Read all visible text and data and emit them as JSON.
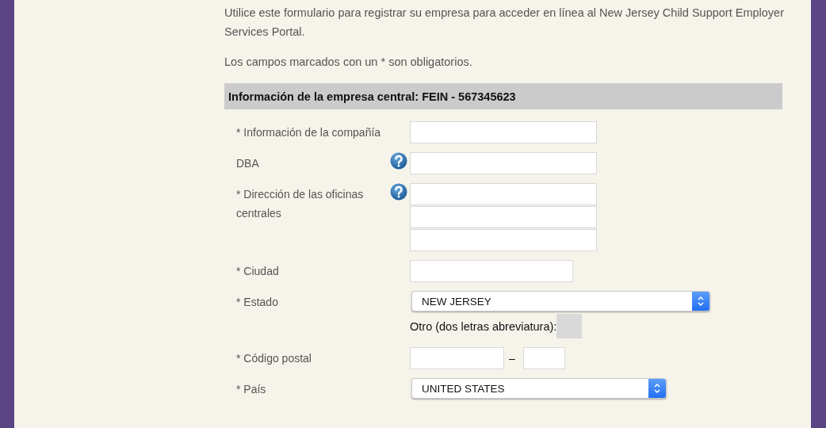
{
  "intro": "Utilice este formulario para registrar su empresa para acceder en línea al New Jersey Child Support Employer Services Portal.",
  "required_note": "Los campos marcados con un * son obligatorios.",
  "section": {
    "title": "Información de la empresa central: FEIN - 567345623"
  },
  "rows": [
    {
      "kind": "text",
      "label": "* Información de la compañía",
      "help": false
    },
    {
      "kind": "text",
      "label": "DBA",
      "help": true
    },
    {
      "kind": "address",
      "label": "* Dirección de las oficinas centrales",
      "help": true
    },
    {
      "kind": "short",
      "label": "* Ciudad",
      "help": false
    },
    {
      "kind": "select",
      "label": "* Estado",
      "help": false,
      "value": "NEW JERSEY",
      "other_label": "Otro (dos letras abreviatura):"
    },
    {
      "kind": "postal",
      "label": "* Código postal",
      "help": false,
      "separator": "–"
    },
    {
      "kind": "select-short",
      "label": "* País",
      "help": false,
      "value": "UNITED STATES"
    }
  ]
}
